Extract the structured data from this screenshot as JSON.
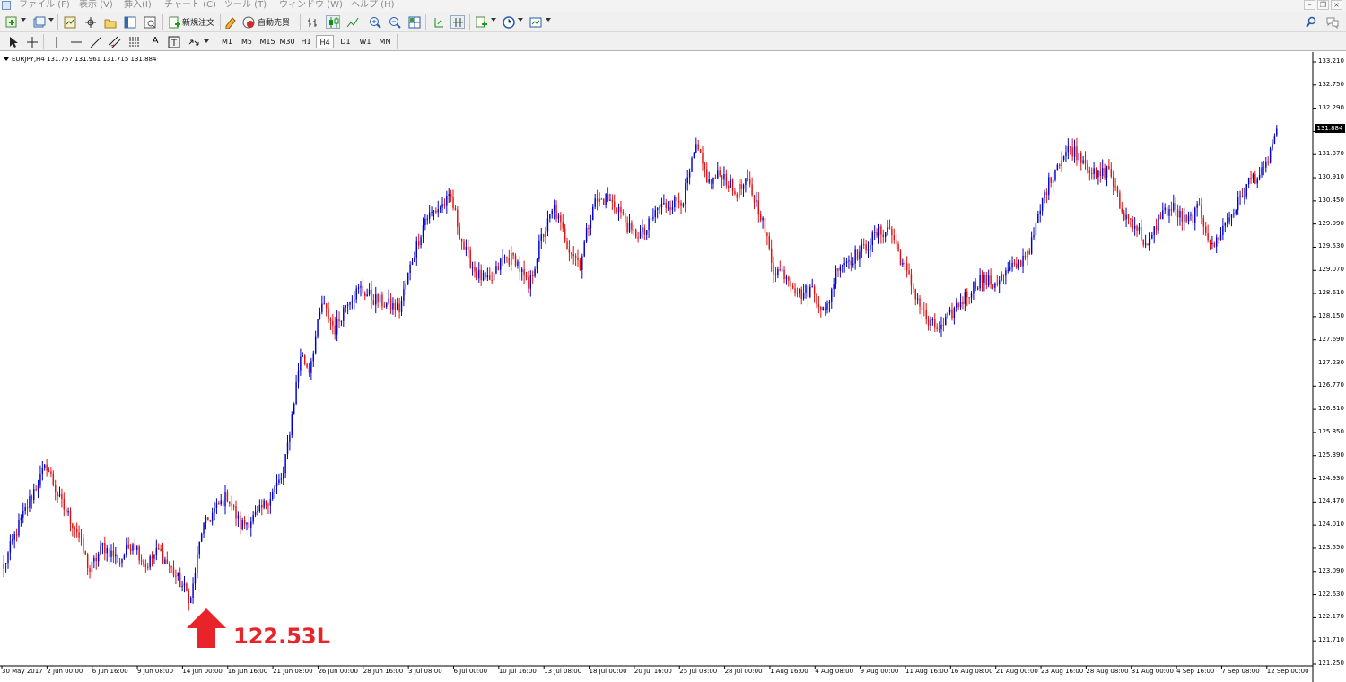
{
  "menu": {
    "items": [
      "ファイル (F)",
      "表示 (V)",
      "挿入(I)",
      "チャート (C)",
      "ツール (T)",
      "ウィンドウ (W)",
      "ヘルプ (H)"
    ]
  },
  "toolbar1": {
    "new_order_label": "新規注文",
    "auto_trading_label": "自動売買"
  },
  "toolbar2": {
    "timeframes": [
      "M1",
      "M5",
      "M15",
      "M30",
      "H1",
      "H4",
      "D1",
      "W1",
      "MN"
    ],
    "active_timeframe": "H4"
  },
  "chart": {
    "title": "EURJPY,H4  131.757 131.961 131.715 131.884",
    "current_price": "131.884",
    "y_tick_labels": [
      "133.210",
      "132.750",
      "132.290",
      "131.830",
      "131.370",
      "130.910",
      "130.450",
      "129.990",
      "129.530",
      "129.070",
      "128.610",
      "128.150",
      "127.690",
      "127.230",
      "126.770",
      "126.310",
      "125.850",
      "125.390",
      "124.930",
      "124.470",
      "124.010",
      "123.550",
      "123.090",
      "122.630",
      "122.170",
      "121.710",
      "121.250"
    ],
    "x_tick_labels": [
      "30 May 2017",
      "2 Jun 00:00",
      "6 Jun 16:00",
      "9 Jun 08:00",
      "14 Jun 00:00",
      "16 Jun 16:00",
      "21 Jun 08:00",
      "26 Jun 00:00",
      "28 Jun 16:00",
      "3 Jul 08:00",
      "6 Jul 00:00",
      "10 Jul 16:00",
      "13 Jul 08:00",
      "18 Jul 00:00",
      "20 Jul 16:00",
      "25 Jul 08:00",
      "28 Jul 00:00",
      "1 Aug 16:00",
      "4 Aug 08:00",
      "9 Aug 00:00",
      "11 Aug 16:00",
      "16 Aug 08:00",
      "21 Aug 00:00",
      "23 Aug 16:00",
      "28 Aug 08:00",
      "31 Aug 00:00",
      "4 Sep 16:00",
      "7 Sep 08:00",
      "12 Sep 00:00"
    ],
    "annotation_text": "122.53L",
    "colors": {
      "bull": "#0000cc",
      "bear": "#e01010",
      "annotation": "#e8232a"
    }
  },
  "chart_data": {
    "type": "candlestick",
    "symbol": "EURJPY",
    "timeframe": "H4",
    "ylim": [
      121.25,
      133.21
    ],
    "last": {
      "open": 131.757,
      "high": 131.961,
      "low": 131.715,
      "close": 131.884
    },
    "low_marker": 122.53,
    "anchors_close": [
      [
        0,
        123.2
      ],
      [
        6,
        123.9
      ],
      [
        14,
        124.7
      ],
      [
        20,
        125.2
      ],
      [
        26,
        124.5
      ],
      [
        34,
        123.9
      ],
      [
        40,
        123.1
      ],
      [
        46,
        123.6
      ],
      [
        54,
        123.3
      ],
      [
        60,
        123.7
      ],
      [
        66,
        123.2
      ],
      [
        72,
        123.5
      ],
      [
        80,
        123.0
      ],
      [
        87,
        122.53
      ],
      [
        92,
        123.9
      ],
      [
        98,
        124.3
      ],
      [
        104,
        124.6
      ],
      [
        110,
        124.0
      ],
      [
        118,
        124.2
      ],
      [
        124,
        124.6
      ],
      [
        130,
        125.0
      ],
      [
        134,
        126.2
      ],
      [
        138,
        127.4
      ],
      [
        142,
        127.1
      ],
      [
        148,
        128.4
      ],
      [
        154,
        127.9
      ],
      [
        160,
        128.5
      ],
      [
        166,
        128.7
      ],
      [
        172,
        128.5
      ],
      [
        178,
        128.4
      ],
      [
        184,
        128.3
      ],
      [
        190,
        129.3
      ],
      [
        196,
        130.1
      ],
      [
        202,
        130.3
      ],
      [
        208,
        130.5
      ],
      [
        214,
        129.5
      ],
      [
        220,
        129.0
      ],
      [
        226,
        128.8
      ],
      [
        232,
        129.3
      ],
      [
        238,
        129.3
      ],
      [
        244,
        128.7
      ],
      [
        250,
        129.7
      ],
      [
        256,
        130.3
      ],
      [
        262,
        129.6
      ],
      [
        268,
        129.2
      ],
      [
        274,
        130.4
      ],
      [
        280,
        130.5
      ],
      [
        286,
        130.3
      ],
      [
        292,
        129.8
      ],
      [
        298,
        129.8
      ],
      [
        304,
        130.3
      ],
      [
        310,
        130.4
      ],
      [
        316,
        130.5
      ],
      [
        322,
        131.5
      ],
      [
        328,
        130.8
      ],
      [
        334,
        131.0
      ],
      [
        340,
        130.6
      ],
      [
        346,
        130.8
      ],
      [
        352,
        130.2
      ],
      [
        358,
        129.1
      ],
      [
        364,
        129.0
      ],
      [
        370,
        128.6
      ],
      [
        376,
        128.7
      ],
      [
        382,
        128.2
      ],
      [
        388,
        129.2
      ],
      [
        394,
        129.3
      ],
      [
        400,
        129.5
      ],
      [
        406,
        129.8
      ],
      [
        412,
        129.9
      ],
      [
        418,
        129.2
      ],
      [
        424,
        128.6
      ],
      [
        430,
        128.0
      ],
      [
        436,
        127.9
      ],
      [
        442,
        128.3
      ],
      [
        448,
        128.6
      ],
      [
        454,
        128.9
      ],
      [
        460,
        128.8
      ],
      [
        466,
        129.0
      ],
      [
        472,
        129.2
      ],
      [
        478,
        129.6
      ],
      [
        484,
        130.6
      ],
      [
        490,
        131.2
      ],
      [
        496,
        131.5
      ],
      [
        502,
        131.3
      ],
      [
        508,
        130.9
      ],
      [
        514,
        131.1
      ],
      [
        520,
        130.2
      ],
      [
        526,
        130.0
      ],
      [
        532,
        129.5
      ],
      [
        538,
        130.2
      ],
      [
        544,
        130.3
      ],
      [
        550,
        130.0
      ],
      [
        556,
        130.3
      ],
      [
        562,
        129.5
      ],
      [
        568,
        130.0
      ],
      [
        574,
        130.4
      ],
      [
        580,
        130.9
      ],
      [
        586,
        131.0
      ],
      [
        592,
        131.884
      ]
    ],
    "candle_count": 593
  }
}
